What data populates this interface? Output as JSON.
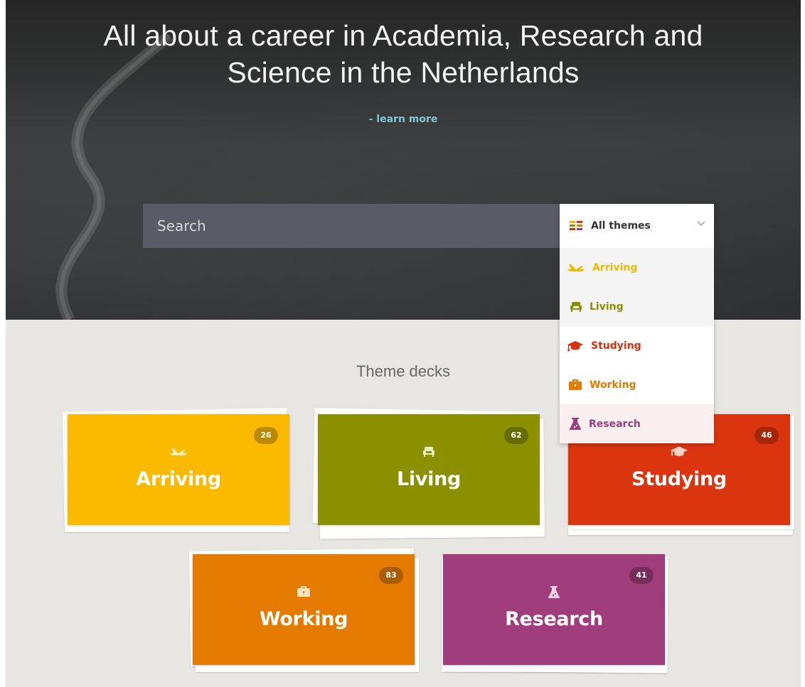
{
  "hero": {
    "title_line1": "All about a career in Academia, Research and",
    "title_line2": "Science in the Netherlands",
    "learn_more": "- learn more"
  },
  "search": {
    "placeholder": "Search"
  },
  "theme_filter": {
    "selected": "All themes",
    "options": [
      {
        "label": "Arriving",
        "color": "#f6b800",
        "icon": "airplane-icon"
      },
      {
        "label": "Living",
        "color": "#8a9000",
        "icon": "armchair-icon"
      },
      {
        "label": "Studying",
        "color": "#d9300f",
        "icon": "graduation-cap-icon"
      },
      {
        "label": "Working",
        "color": "#e57a00",
        "icon": "briefcase-icon"
      },
      {
        "label": "Research",
        "color": "#9b3e7c",
        "icon": "flask-icon"
      }
    ]
  },
  "theme_decks": {
    "title": "Theme decks",
    "decks": [
      {
        "label": "Arriving",
        "count": "26",
        "color": "#fbb900",
        "icon": "airplane-icon"
      },
      {
        "label": "Living",
        "count": "62",
        "color": "#8a9000",
        "icon": "armchair-icon"
      },
      {
        "label": "Studying",
        "count": "46",
        "color": "#db3510",
        "icon": "graduation-cap-icon"
      },
      {
        "label": "Working",
        "count": "83",
        "color": "#e57a00",
        "icon": "briefcase-icon"
      },
      {
        "label": "Research",
        "count": "41",
        "color": "#a03e7d",
        "icon": "flask-icon"
      }
    ]
  }
}
